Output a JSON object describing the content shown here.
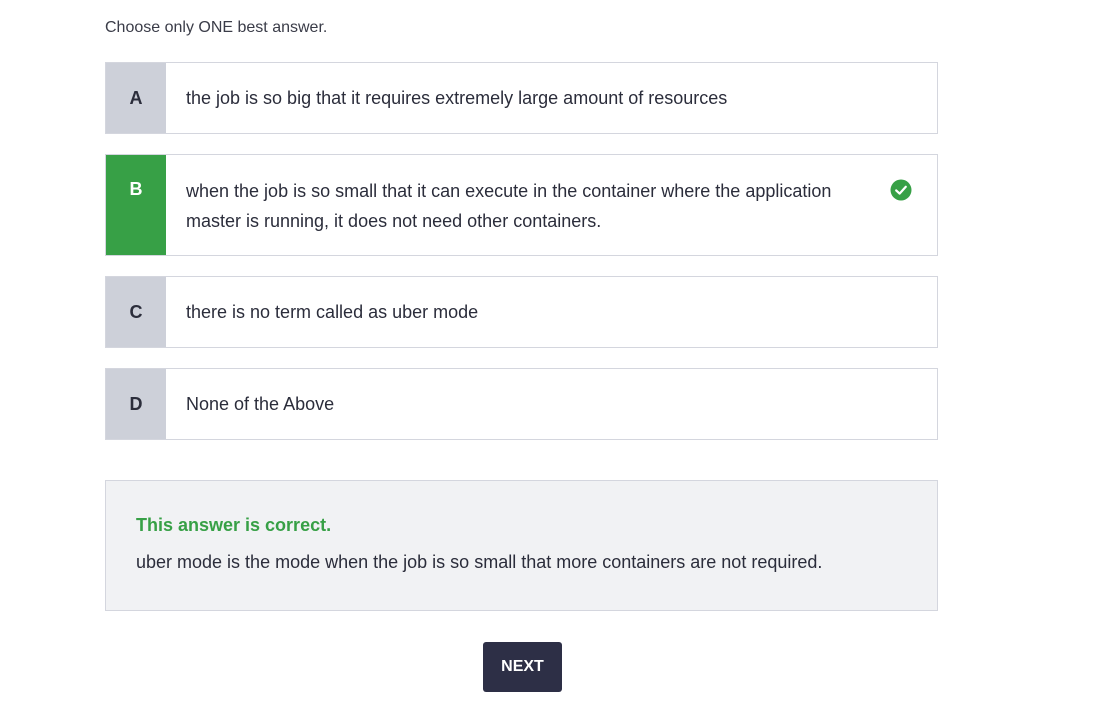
{
  "instruction": "Choose only ONE best answer.",
  "options": [
    {
      "letter": "A",
      "text": "the job is so big that it requires extremely large amount of resources"
    },
    {
      "letter": "B",
      "text": "when the job is so small that it can execute in the container where the application master is running, it does not need other containers."
    },
    {
      "letter": "C",
      "text": "there is no term called as uber mode"
    },
    {
      "letter": "D",
      "text": "None of the Above"
    }
  ],
  "selected_option": "B",
  "check_icon": "check-circle-icon",
  "feedback": {
    "title": "This answer is correct.",
    "explanation": "uber mode is the mode when the job is so small that more containers are not required."
  },
  "next_label": "NEXT",
  "colors": {
    "correct": "#37a046",
    "letter_bg": "#cdd0d9",
    "button_bg": "#2d2f46"
  }
}
